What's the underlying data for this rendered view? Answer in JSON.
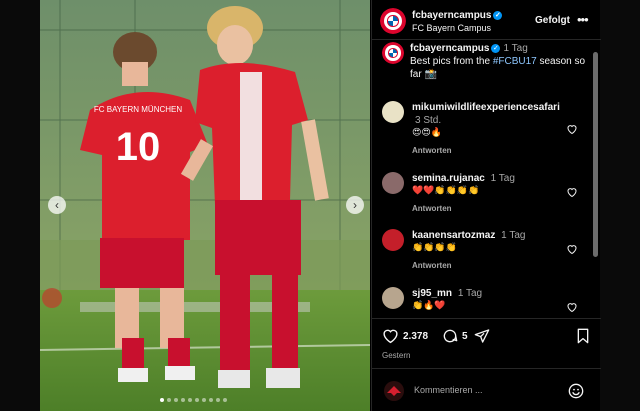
{
  "post": {
    "account": "fcbayerncampus",
    "account_subtitle": "FC Bayern Campus",
    "follow_label": "Gefolgt",
    "more_icon": "more-options-icon",
    "jersey_front_text": "FC BAYERN MÜNCHEN",
    "jersey_number": "10",
    "caption_time": "1 Tag",
    "caption_text_before": "Best pics from the ",
    "caption_hashtag": "#FCBU17",
    "caption_text_after": " season so far 📸",
    "likes": "2.378",
    "comments_count": "5",
    "date": "Gestern",
    "comment_placeholder": "Kommentieren ...",
    "reply_label": "Antworten",
    "carousel_total": 10,
    "carousel_index": 1
  },
  "comments": [
    {
      "user": "mikumiwildlifeexperiencesafari",
      "time": "3 Std.",
      "text": "😍😍🔥",
      "avatar_color": "#e9e2c6"
    },
    {
      "user": "semina.rujanac",
      "time": "1 Tag",
      "text": "❤️❤️👏👏👏👏",
      "avatar_color": "#8a6a6a"
    },
    {
      "user": "kaanensartozmaz",
      "time": "1 Tag",
      "text": "👏👏👏👏",
      "avatar_color": "#c41f2a"
    },
    {
      "user": "sj95_mn",
      "time": "1 Tag",
      "text": "👏🔥❤️",
      "avatar_color": "#b7a58e"
    }
  ],
  "colors": {
    "accent_blue": "#0095f6",
    "bayern_red": "#dc052d",
    "muted_text": "#a8a8a8"
  }
}
